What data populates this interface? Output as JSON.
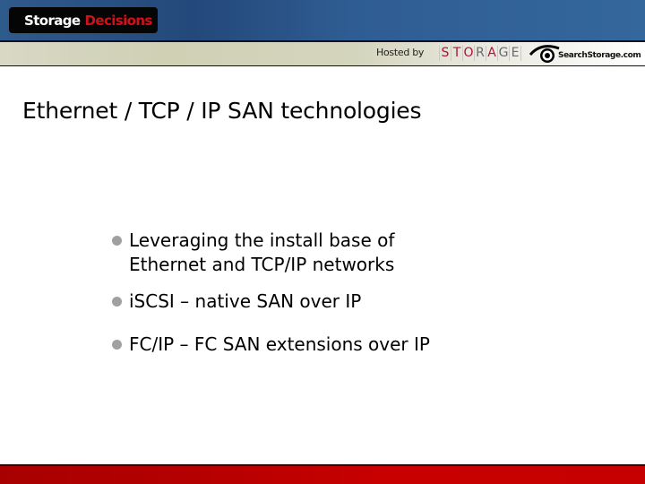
{
  "header": {
    "brand_primary": "Storage",
    "brand_secondary": "Decisions",
    "hosted_by_label": "Hosted by",
    "sponsor_logo_letters": [
      "S",
      "T",
      "O",
      "R",
      "A",
      "G",
      "E"
    ],
    "sponsor_logo_colors": [
      "#b0103a",
      "#b0103a",
      "#b0103a",
      "#6a6a6a",
      "#b0103a",
      "#6a6a6a",
      "#6a6a6a"
    ],
    "partner_logo_text": "SearchStorage.com",
    "colors": {
      "top_bar": "#2a5288",
      "brand_box": "#050505",
      "brand_accent": "#d0101a",
      "host_band": "#d2d3ba"
    }
  },
  "slide": {
    "title": "Ethernet / TCP / IP SAN technologies",
    "bullets": [
      {
        "line1": "Leveraging the install base of",
        "line2": "Ethernet and TCP/IP networks"
      },
      {
        "line1": "iSCSI – native SAN over IP"
      },
      {
        "line1": "FC/IP – FC SAN extensions over IP"
      }
    ],
    "bullet_color": "#a0a0a0"
  },
  "footer": {
    "bar_color": "#c40000"
  }
}
